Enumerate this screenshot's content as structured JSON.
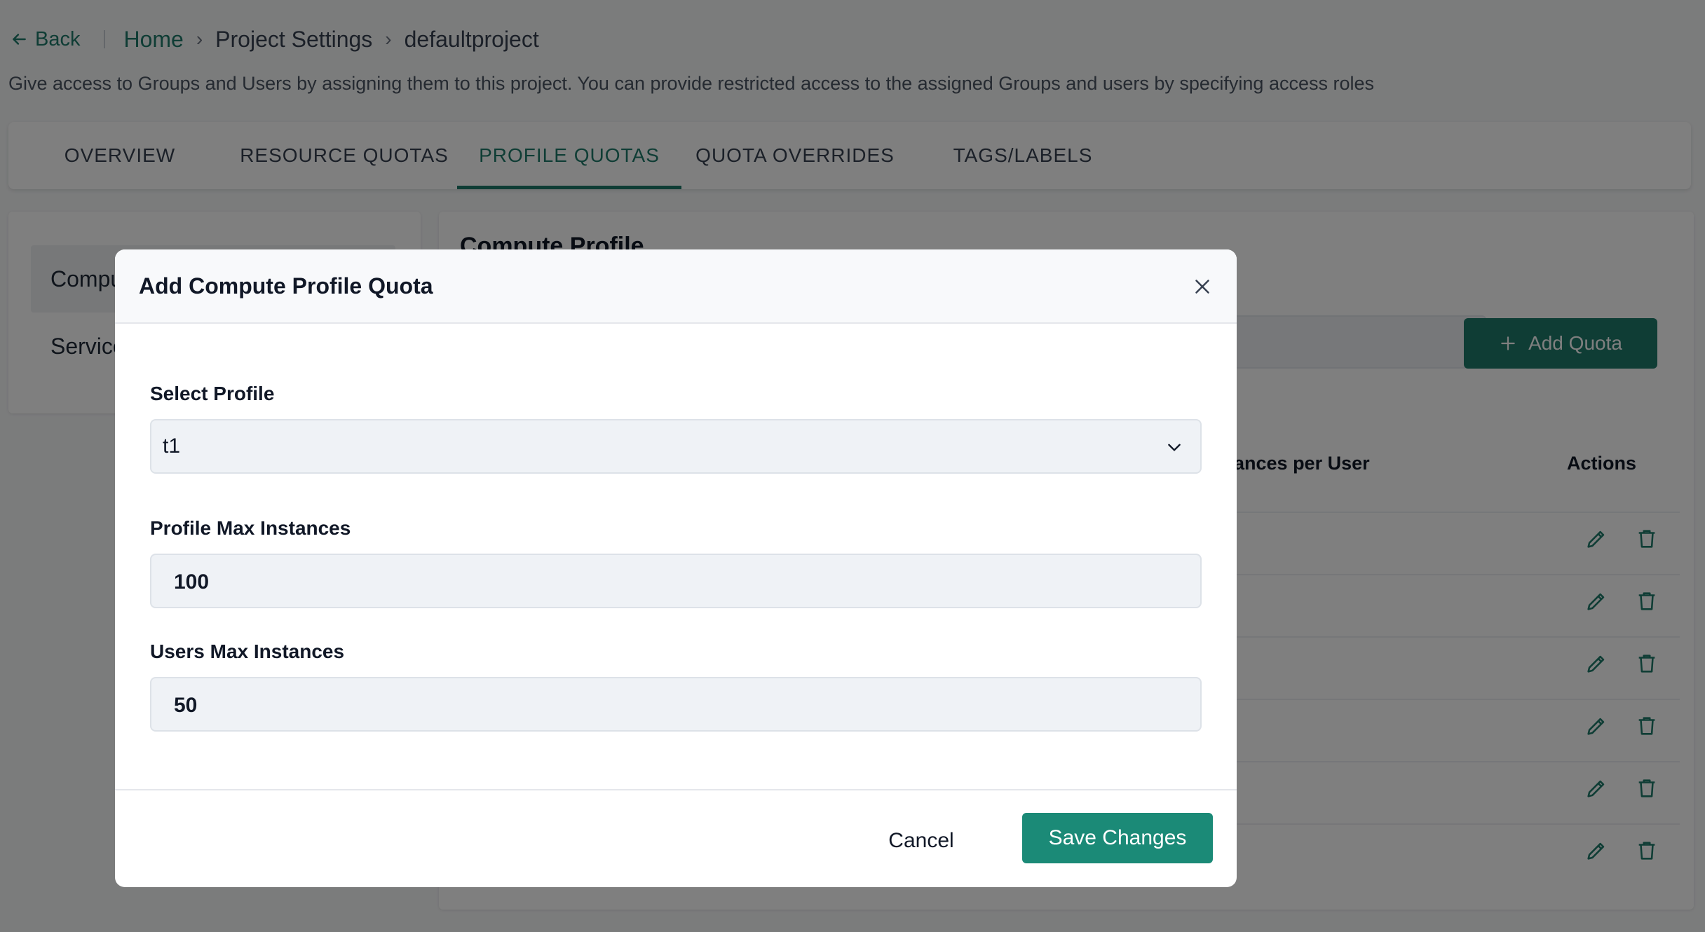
{
  "breadcrumb": {
    "back_label": "Back",
    "home": "Home",
    "section": "Project Settings",
    "current": "defaultproject"
  },
  "description": "Give access to Groups and Users by assigning them to this project. You can provide restricted access to the assigned Groups and users by specifying access roles",
  "tabs": [
    {
      "label": "OVERVIEW"
    },
    {
      "label": "RESOURCE QUOTAS"
    },
    {
      "label": "PROFILE QUOTAS"
    },
    {
      "label": "QUOTA OVERRIDES"
    },
    {
      "label": "TAGS/LABELS"
    }
  ],
  "active_tab": "PROFILE QUOTAS",
  "sidebar": {
    "items": [
      {
        "label": "Compu"
      },
      {
        "label": "Service"
      }
    ]
  },
  "main": {
    "title": "Compute Profile",
    "add_quota_label": "Add Quota",
    "columns": {
      "per_user": "stances per User",
      "actions": "Actions"
    },
    "row_count": 6
  },
  "modal": {
    "title": "Add Compute Profile Quota",
    "select_profile_label": "Select Profile",
    "select_profile_value": "t1",
    "profile_max_label": "Profile Max Instances",
    "profile_max_value": "100",
    "users_max_label": "Users Max Instances",
    "users_max_value": "50",
    "cancel_label": "Cancel",
    "save_label": "Save Changes"
  },
  "colors": {
    "accent": "#1f7a6a",
    "save_button": "#1b8a77"
  }
}
